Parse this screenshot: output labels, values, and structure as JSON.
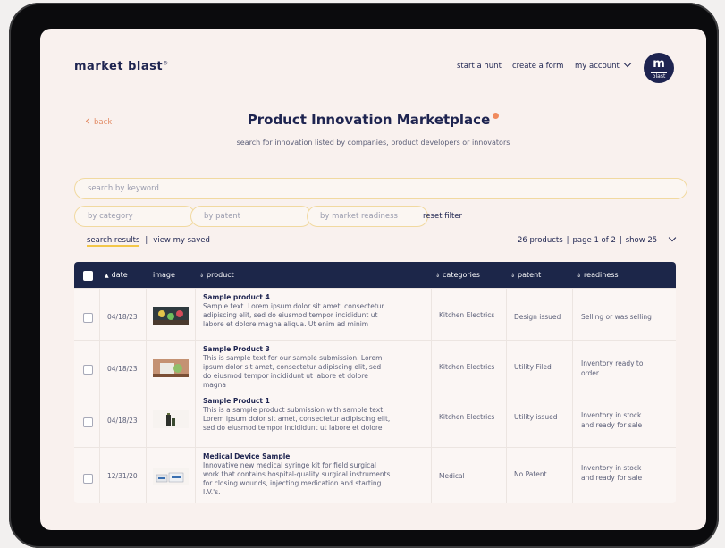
{
  "brand": {
    "logo": "market blast",
    "avatar_main": "m",
    "avatar_sub": "blast"
  },
  "nav": {
    "hunt": "start a hunt",
    "form": "create a form",
    "account": "my account"
  },
  "page": {
    "back": "back",
    "title": "Product Innovation Marketplace",
    "subtitle": "search for innovation listed by companies, product developers or innovators"
  },
  "search": {
    "placeholder": "search by keyword"
  },
  "filters": {
    "category": "by category",
    "patent": "by patent",
    "readiness": "by market readiness",
    "reset": "reset filter"
  },
  "tabs": {
    "results": "search results",
    "saved": "view my saved"
  },
  "meta": {
    "count": "26 products",
    "page": "page 1 of 2",
    "show": "show 25"
  },
  "table": {
    "headers": {
      "date": "date",
      "image": "image",
      "product": "product",
      "categories": "categories",
      "patent": "patent",
      "readiness": "readiness"
    },
    "rows": [
      {
        "date": "04/18/23",
        "name": "Sample product 4",
        "desc": "Sample text. Lorem ipsum dolor sit amet, consectetur adipiscing elit, sed do eiusmod tempor incididunt ut labore et dolore magna aliqua. Ut enim ad minim",
        "category": "Kitchen Electrics",
        "patent": "Design issued",
        "readiness": "Selling or was selling"
      },
      {
        "date": "04/18/23",
        "name": "Sample Product 3",
        "desc": "This is sample text for our sample submission. Lorem ipsum dolor sit amet, consectetur adipiscing elit, sed do eiusmod tempor incididunt ut labore et dolore magna",
        "category": "Kitchen Electrics",
        "patent": "Utility Filed",
        "readiness": "Inventory ready to order"
      },
      {
        "date": "04/18/23",
        "name": "Sample Product 1",
        "desc": "This is a sample product submission with sample text. Lorem ipsum dolor sit amet, consectetur adipiscing elit, sed do eiusmod tempor incididunt ut labore et dolore",
        "category": "Kitchen Electrics",
        "patent": "Utility issued",
        "readiness": "Inventory in stock and ready for sale"
      },
      {
        "date": "12/31/20",
        "name": "Medical Device Sample",
        "desc": "Innovative new medical syringe kit for field surgical work that contains hospital-quality surgical instruments for closing wounds, injecting medication and starting I.V.'s.",
        "category": "Medical",
        "patent": "No Patent",
        "readiness": "Inventory in stock and ready for sale"
      }
    ]
  }
}
